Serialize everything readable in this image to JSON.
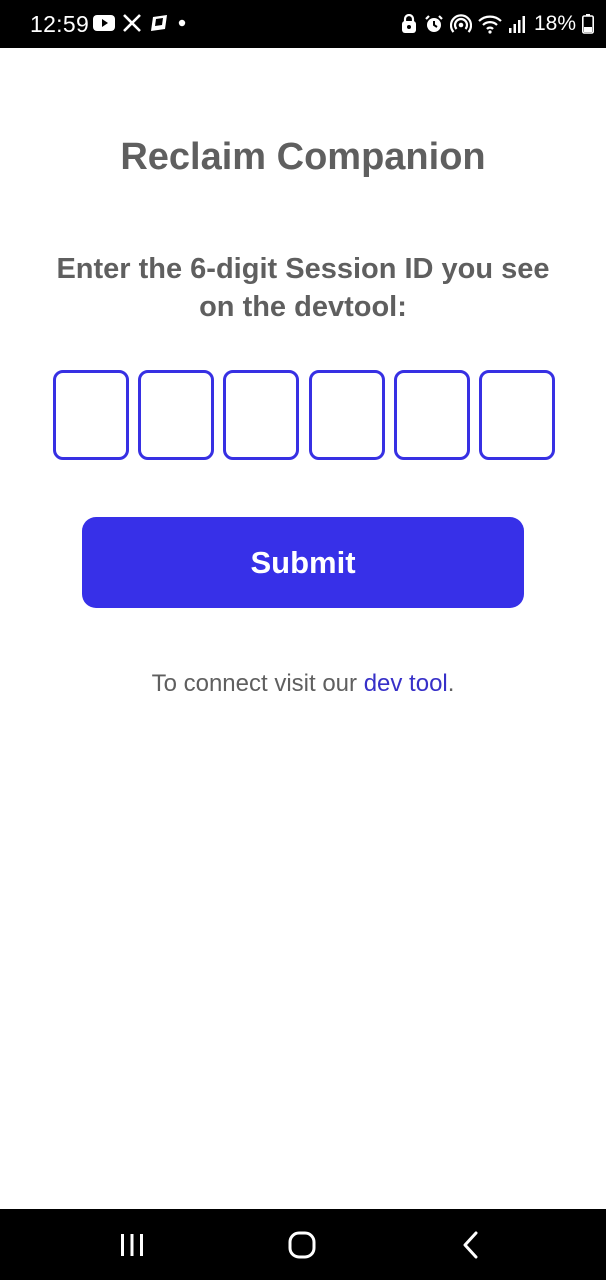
{
  "status_bar": {
    "time": "12:59",
    "left_icons": [
      "youtube-icon",
      "x-icon",
      "app-icon",
      "dot-icon"
    ],
    "right_icons": [
      "lock-icon",
      "alarm-icon",
      "hotspot-icon",
      "wifi-icon",
      "signal-icon",
      "battery-icon"
    ],
    "battery": "18%"
  },
  "main": {
    "title": "Reclaim Companion",
    "instructions": "Enter the 6-digit Session ID you see on the devtool:",
    "code_boxes": [
      "",
      "",
      "",
      "",
      "",
      ""
    ],
    "submit_label": "Submit",
    "connect_prefix": "To connect visit our ",
    "connect_link": "dev tool",
    "connect_suffix": "."
  },
  "nav_bar": {
    "buttons": [
      "recents-icon",
      "home-icon",
      "back-icon"
    ]
  },
  "colors": {
    "accent": "#3730e8",
    "text_gray": "#5f5f5f",
    "link": "#3730c8"
  }
}
